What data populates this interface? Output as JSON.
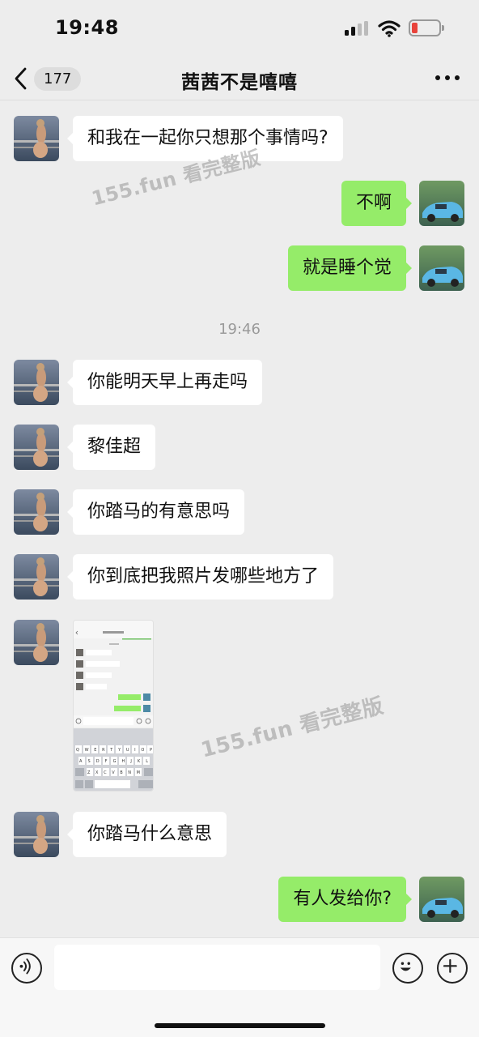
{
  "status_bar": {
    "time": "19:48"
  },
  "nav": {
    "unread_count": "177",
    "title": "茜茜不是嘻嘻"
  },
  "messages": [
    {
      "side": "left",
      "text": "和我在一起你只想那个事情吗?"
    },
    {
      "side": "right",
      "text": "不啊"
    },
    {
      "side": "right",
      "text": "就是睡个觉"
    },
    {
      "side": "left",
      "text": " 你能明天早上再走吗"
    },
    {
      "side": "left",
      "text": "黎佳超"
    },
    {
      "side": "left",
      "text": "你踏马的有意思吗"
    },
    {
      "side": "left",
      "text": "你到底把我照片发哪些地方了"
    },
    {
      "side": "left",
      "text": "你踏马什么意思"
    },
    {
      "side": "right",
      "text": "有人发给你?"
    }
  ],
  "timestamp": "19:46",
  "watermarks": [
    "155.fun 看完整版",
    "155.fun 看完整版"
  ],
  "image_message": {
    "type": "screenshot",
    "keyboard_row1": "Q W E R T Y U I O P",
    "keyboard_row2": "A S D F G H J K L",
    "keyboard_row3": "Z X C V B N M"
  },
  "colors": {
    "background": "#ededed",
    "incoming_bubble": "#ffffff",
    "outgoing_bubble": "#95ec69",
    "battery_low": "#e8433b"
  },
  "icons": {
    "back": "chevron-left-icon",
    "more": "more-dots-icon",
    "voice": "voice-icon",
    "emoji": "emoji-icon",
    "plus": "plus-icon"
  }
}
